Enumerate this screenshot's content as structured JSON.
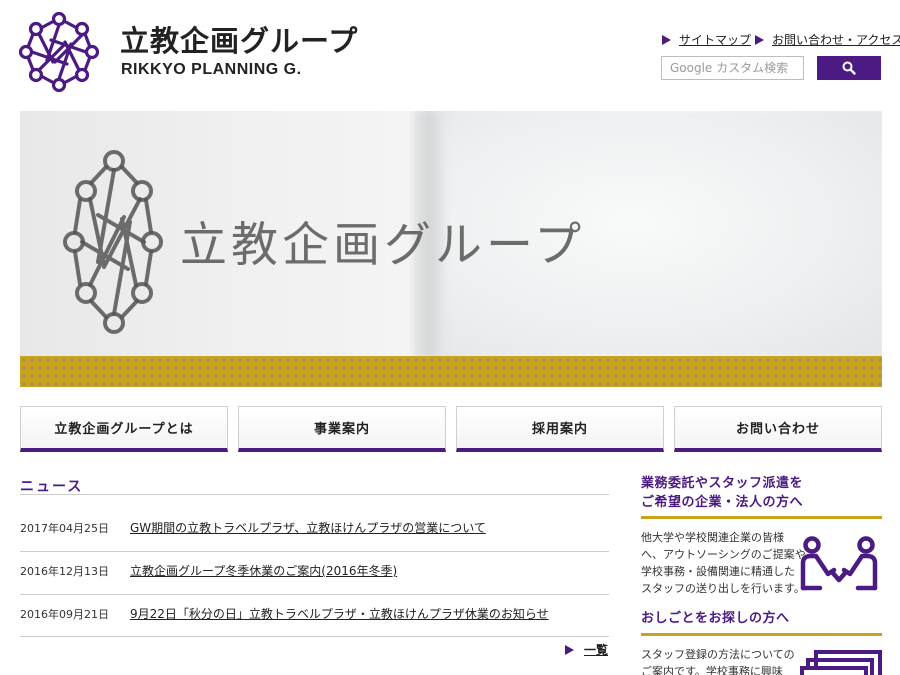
{
  "brand": {
    "name_jp": "立教企画グループ",
    "name_en": "RIKKYO PLANNING G."
  },
  "utility_nav": {
    "sitemap": "サイトマップ",
    "contact_access": "お問い合わせ・アクセス"
  },
  "search": {
    "placeholder": "Google カスタム検索"
  },
  "hero": {
    "signage_text": "立教企画グループ"
  },
  "main_nav": [
    {
      "label": "立教企画グループとは"
    },
    {
      "label": "事業案内"
    },
    {
      "label": "採用案内"
    },
    {
      "label": "お問い合わせ"
    }
  ],
  "news": {
    "heading": "ニュース",
    "items": [
      {
        "date": "2017年04月25日",
        "title": "GW期間の立教トラベルプラザ、立教ほけんプラザの営業について"
      },
      {
        "date": "2016年12月13日",
        "title": "立教企画グループ冬季休業のご案内(2016年冬季)"
      },
      {
        "date": "2016年09月21日",
        "title": "9月22日「秋分の日」立教トラベルプラザ・立教ほけんプラザ休業のお知らせ"
      }
    ],
    "more_label": "一覧"
  },
  "sidebar": {
    "business": {
      "heading_line1": "業務委託やスタッフ派遣を",
      "heading_line2": "ご希望の企業・法人の方へ",
      "text": [
        "他大学や学校関連企業の皆様",
        "へ、アウトソーシングのご提案や",
        "学校事務・設備関連に精通した",
        "スタッフの送り出しを行います。"
      ]
    },
    "jobs": {
      "heading": "おしごとをお探しの方へ",
      "text": [
        "スタッフ登録の方法についての",
        "ご案内です。学校事務に興味"
      ]
    }
  },
  "colors": {
    "brand_purple": "#4b1a82",
    "accent_gold": "#c9a31c"
  }
}
